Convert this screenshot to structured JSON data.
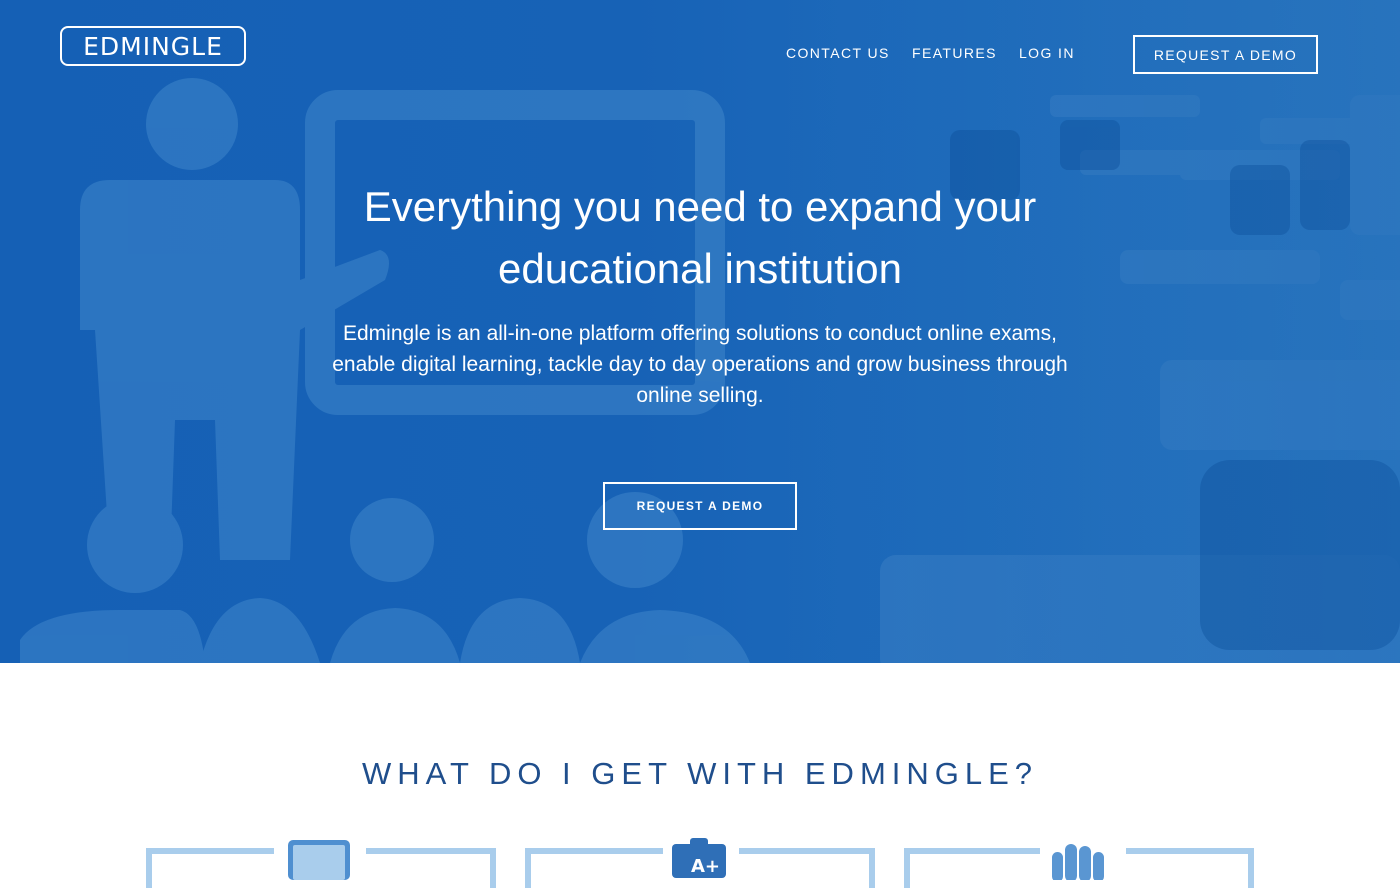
{
  "brand": {
    "logo_text": "EDMINGLE"
  },
  "nav": {
    "contact_label": "CONTACT US",
    "features_label": "FEATURES",
    "login_label": "LOG IN",
    "demo_label": "REQUEST A DEMO"
  },
  "hero": {
    "title_line1": "Everything you need to expand your",
    "title_line2": "educational institution",
    "subtitle_line1": "Edmingle is an all-in-one platform offering solutions to conduct online exams,",
    "subtitle_line2": "enable digital learning, tackle day to day operations and grow business through",
    "subtitle_line3": "online selling.",
    "cta_label": "REQUEST A DEMO"
  },
  "features": {
    "title": "WHAT DO I GET WITH EDMINGLE?",
    "cards": [
      {
        "icon": "tablet-icon"
      },
      {
        "icon": "grade-report-icon",
        "grade": "A+"
      },
      {
        "icon": "hand-icon"
      }
    ]
  },
  "colors": {
    "hero_blue": "#1762b6",
    "section_title": "#1f4e8c",
    "card_frame": "#a9cdec"
  }
}
